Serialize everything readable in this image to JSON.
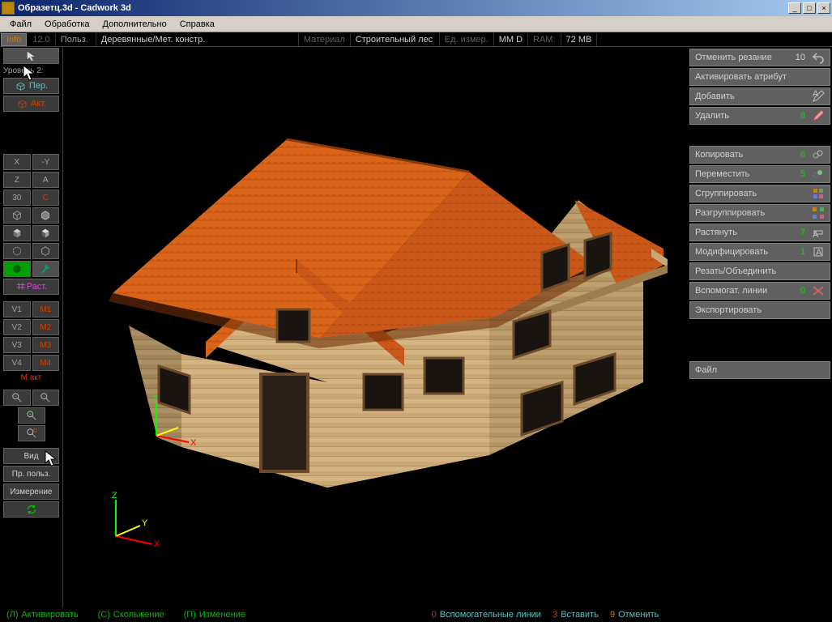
{
  "window": {
    "title": "Образетц.3d - Cadwork 3d"
  },
  "menu": {
    "file": "Файл",
    "edit": "Обработка",
    "extras": "Дополнительно",
    "help": "Справка"
  },
  "infobar": {
    "info": "Info",
    "ver": "12.0",
    "user": "Польз.",
    "mode": "Деревянные/Мет. констр.",
    "material": "Материал",
    "mattype": "Строительный лес",
    "units": "Ед. измер.",
    "mm": "ММ  D",
    "ram": "RAM:",
    "ramval": "72 MB"
  },
  "left": {
    "level": "Уровень 2:",
    "per": "Пер.",
    "akt": "Акт.",
    "x": "X",
    "ny": "-Y",
    "z": "Z",
    "a": "A",
    "d30": "30",
    "c": "C",
    "rast": "Раст.",
    "v1": "V1",
    "v2": "V2",
    "v3": "V3",
    "v4": "V4",
    "m1": "M1",
    "m2": "M2",
    "m3": "M3",
    "m4": "M4",
    "mact": "М акт",
    "view": "Вид",
    "userpr": "Пр. польз.",
    "measure": "Измерение"
  },
  "right": {
    "undo_cut": "Отменить резание",
    "undo_cut_n": "10",
    "activate_attr": "Активировать атрибут",
    "add": "Добавить",
    "delete": "Удалить",
    "delete_n": "8",
    "copy": "Копировать",
    "copy_n": "6",
    "move": "Переместить",
    "move_n": "5",
    "group": "Сгруппировать",
    "ungroup": "Разгруппировать",
    "stretch": "Растянуть",
    "stretch_n": "7",
    "modify": "Модифицировать",
    "modify_n": "1",
    "cutjoin": "Резать/Объединить",
    "helper": "Вспомогат. линии",
    "helper_n": "0",
    "export": "Экспортировать",
    "file": "Файл"
  },
  "status": {
    "l": "(Л)",
    "l_txt": "Активировать",
    "c": "(С)",
    "c_txt": "Скольжение",
    "p": "(П)",
    "p_txt": "Изменение",
    "n0": "0",
    "t0": "Вспомогательные линии",
    "n3": "3",
    "t3": "Вставить",
    "n9": "9",
    "t9": "Отменить"
  },
  "axes": {
    "x": "X",
    "y": "Y",
    "z": "Z"
  }
}
